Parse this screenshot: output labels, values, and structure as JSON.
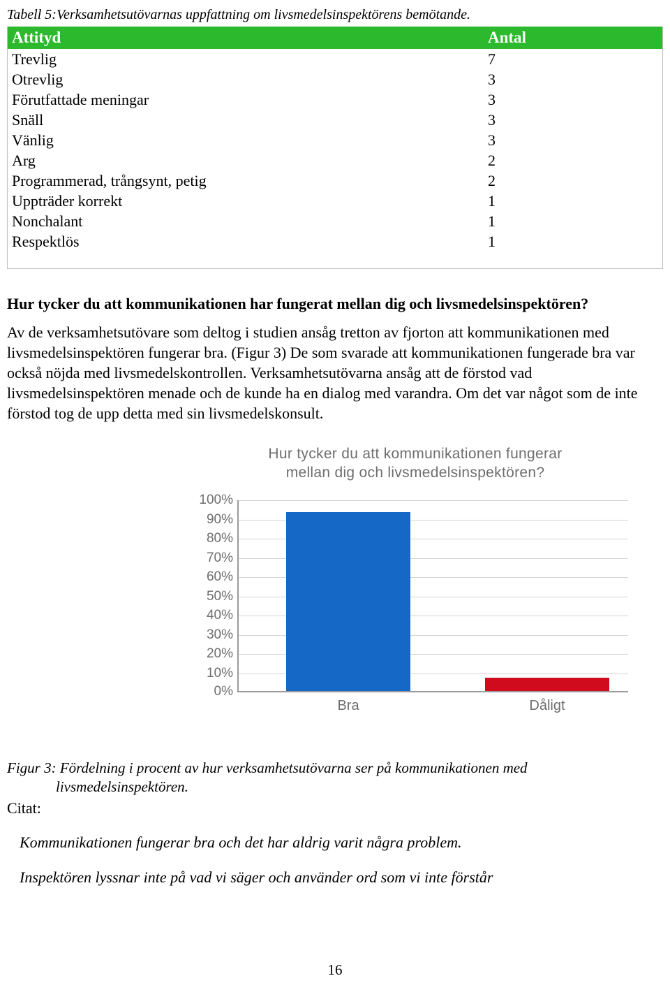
{
  "document": {
    "table_caption": "Tabell 5:Verksamhetsutövarnas uppfattning om livsmedelsinspektörens bemötande.",
    "table": {
      "headers": [
        "Attityd",
        "Antal"
      ],
      "rows": [
        {
          "attityd": "Trevlig",
          "antal": "7"
        },
        {
          "attityd": "Otrevlig",
          "antal": "3"
        },
        {
          "attityd": "Förutfattade meningar",
          "antal": "3"
        },
        {
          "attityd": "Snäll",
          "antal": "3"
        },
        {
          "attityd": "Vänlig",
          "antal": "3"
        },
        {
          "attityd": "Arg",
          "antal": "2"
        },
        {
          "attityd": "Programmerad, trångsynt, petig",
          "antal": "2"
        },
        {
          "attityd": "Uppträder korrekt",
          "antal": "1"
        },
        {
          "attityd": "Nonchalant",
          "antal": "1"
        },
        {
          "attityd": "Respektlös",
          "antal": "1"
        }
      ]
    },
    "question_heading": "Hur tycker du att kommunikationen har fungerat mellan dig och  livsmedelsinspektören?",
    "paragraph": "Av de verksamhetsutövare som deltog i studien ansåg tretton av fjorton att kommunikationen med livsmedelsinspektören fungerar bra. (Figur 3) De som svarade att kommunikationen fungerade bra var också nöjda med livsmedelskontrollen. Verksamhetsutövarna ansåg att de förstod vad livsmedelsinspektören menade och de kunde ha en dialog med varandra. Om det var något som de inte förstod tog de upp detta med sin livsmedelskonsult.",
    "figure_caption_line1": "Figur 3: Fördelning i procent av hur verksamhetsutövarna ser på kommunikationen med",
    "figure_caption_line2": "livsmedelsinspektören.",
    "citat_label": "Citat:",
    "quotes": [
      "Kommunikationen fungerar bra och det har aldrig varit några problem.",
      "Inspektören lyssnar inte på vad vi säger och använder ord som vi inte förstår"
    ],
    "page_number": "16"
  },
  "chart_data": {
    "type": "bar",
    "title": "Hur tycker du att kommunikationen fungerar mellan dig och livsmedelsinspektören?",
    "title_line1": "Hur tycker du att kommunikationen fungerar",
    "title_line2": "mellan dig och livsmedelsinspektören?",
    "categories": [
      "Bra",
      "Dåligt"
    ],
    "values": [
      93,
      7
    ],
    "xlabel": "",
    "ylabel": "",
    "ylim": [
      0,
      100
    ],
    "yticks": [
      "100%",
      "90%",
      "80%",
      "70%",
      "60%",
      "50%",
      "40%",
      "30%",
      "20%",
      "10%",
      "0%"
    ],
    "grid": true,
    "legend": "none",
    "colors": {
      "bra": "#1668c6",
      "daligt": "#d00b1e"
    }
  }
}
